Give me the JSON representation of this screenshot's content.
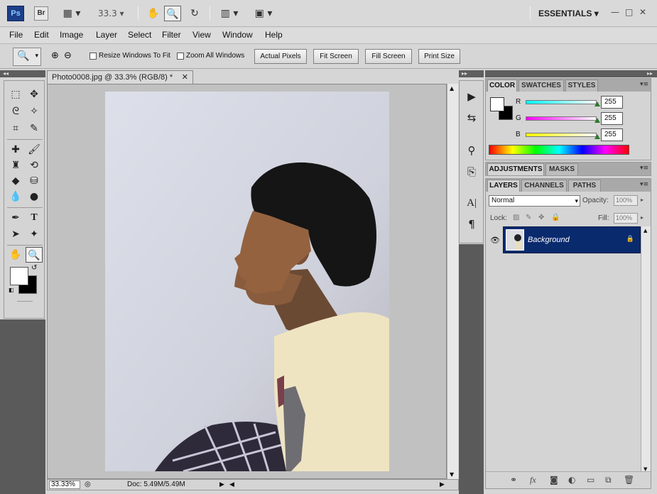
{
  "app": {
    "logo": "Ps",
    "bridge": "Br",
    "zoom": "33.3",
    "workspace": "ESSENTIALS"
  },
  "menu": [
    "File",
    "Edit",
    "Image",
    "Layer",
    "Select",
    "Filter",
    "View",
    "Window",
    "Help"
  ],
  "options": {
    "resize_windows": "Resize Windows To Fit",
    "zoom_all": "Zoom All Windows",
    "buttons": [
      "Actual Pixels",
      "Fit Screen",
      "Fill Screen",
      "Print Size"
    ]
  },
  "document": {
    "tab_title": "Photo0008.jpg @ 33.3% (RGB/8) *",
    "status_zoom": "33.33%",
    "status_doc": "Doc: 5.49M/5.49M"
  },
  "color_panel": {
    "tabs": [
      "COLOR",
      "SWATCHES",
      "STYLES"
    ],
    "channels": [
      {
        "label": "R",
        "value": "255"
      },
      {
        "label": "G",
        "value": "255"
      },
      {
        "label": "B",
        "value": "255"
      }
    ]
  },
  "adjust_panel": {
    "tabs": [
      "ADJUSTMENTS",
      "MASKS"
    ]
  },
  "layers_panel": {
    "tabs": [
      "LAYERS",
      "CHANNELS",
      "PATHS"
    ],
    "blend_mode": "Normal",
    "opacity_label": "Opacity:",
    "opacity": "100%",
    "lock_label": "Lock:",
    "fill_label": "Fill:",
    "fill": "100%",
    "layer_name": "Background"
  }
}
